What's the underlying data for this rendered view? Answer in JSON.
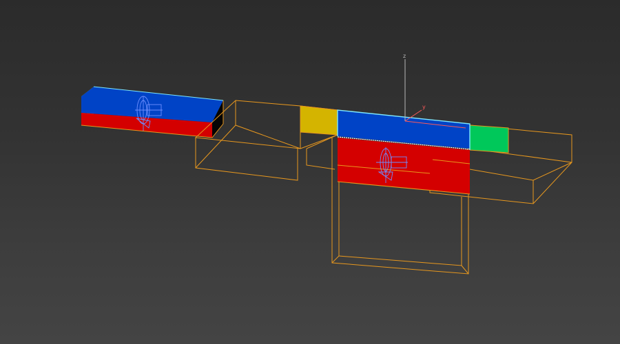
{
  "viewport": {
    "background_top": "#2b2b2b",
    "background_bottom": "#444444"
  },
  "colors": {
    "selection_wireframe": "#e8981e",
    "active_outline": "#7fe8ff",
    "face_blue": "#0043c6",
    "face_red": "#d40000",
    "face_yellow": "#d4b400",
    "face_green": "#00c85a",
    "face_black": "#050505",
    "gizmo_wire": "#6f8fff",
    "axis_z": "#b8b8b8",
    "axis_y": "#ff5a5a"
  },
  "gizmo": {
    "z_label": "z",
    "y_label": "y"
  },
  "icons": [
    "pivot-gizmo-icon",
    "pivot-gizmo-icon",
    "transform-axis-icon"
  ]
}
